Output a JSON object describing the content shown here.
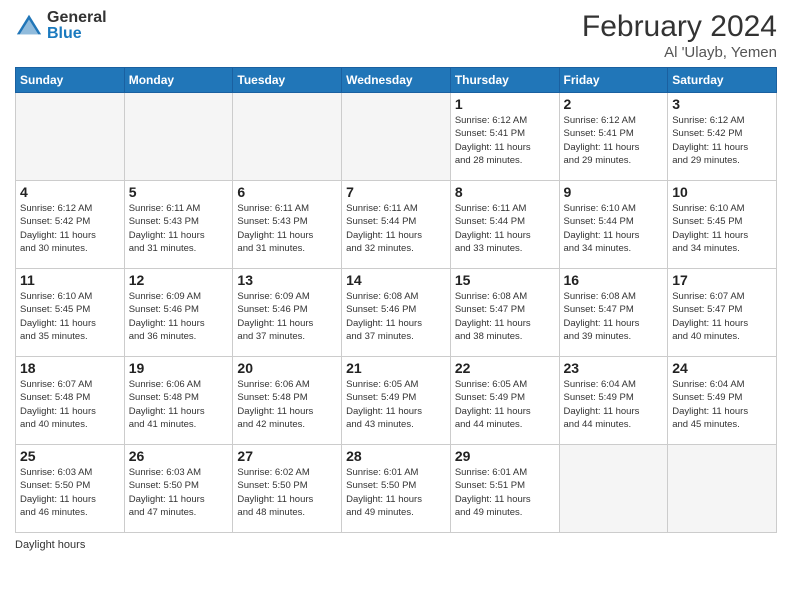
{
  "header": {
    "logo_general": "General",
    "logo_blue": "Blue",
    "title": "February 2024",
    "subtitle": "Al 'Ulayb, Yemen"
  },
  "days_of_week": [
    "Sunday",
    "Monday",
    "Tuesday",
    "Wednesday",
    "Thursday",
    "Friday",
    "Saturday"
  ],
  "footer": {
    "label": "Daylight hours"
  },
  "weeks": [
    [
      {
        "num": "",
        "detail": ""
      },
      {
        "num": "",
        "detail": ""
      },
      {
        "num": "",
        "detail": ""
      },
      {
        "num": "",
        "detail": ""
      },
      {
        "num": "1",
        "detail": "Sunrise: 6:12 AM\nSunset: 5:41 PM\nDaylight: 11 hours\nand 28 minutes."
      },
      {
        "num": "2",
        "detail": "Sunrise: 6:12 AM\nSunset: 5:41 PM\nDaylight: 11 hours\nand 29 minutes."
      },
      {
        "num": "3",
        "detail": "Sunrise: 6:12 AM\nSunset: 5:42 PM\nDaylight: 11 hours\nand 29 minutes."
      }
    ],
    [
      {
        "num": "4",
        "detail": "Sunrise: 6:12 AM\nSunset: 5:42 PM\nDaylight: 11 hours\nand 30 minutes."
      },
      {
        "num": "5",
        "detail": "Sunrise: 6:11 AM\nSunset: 5:43 PM\nDaylight: 11 hours\nand 31 minutes."
      },
      {
        "num": "6",
        "detail": "Sunrise: 6:11 AM\nSunset: 5:43 PM\nDaylight: 11 hours\nand 31 minutes."
      },
      {
        "num": "7",
        "detail": "Sunrise: 6:11 AM\nSunset: 5:44 PM\nDaylight: 11 hours\nand 32 minutes."
      },
      {
        "num": "8",
        "detail": "Sunrise: 6:11 AM\nSunset: 5:44 PM\nDaylight: 11 hours\nand 33 minutes."
      },
      {
        "num": "9",
        "detail": "Sunrise: 6:10 AM\nSunset: 5:44 PM\nDaylight: 11 hours\nand 34 minutes."
      },
      {
        "num": "10",
        "detail": "Sunrise: 6:10 AM\nSunset: 5:45 PM\nDaylight: 11 hours\nand 34 minutes."
      }
    ],
    [
      {
        "num": "11",
        "detail": "Sunrise: 6:10 AM\nSunset: 5:45 PM\nDaylight: 11 hours\nand 35 minutes."
      },
      {
        "num": "12",
        "detail": "Sunrise: 6:09 AM\nSunset: 5:46 PM\nDaylight: 11 hours\nand 36 minutes."
      },
      {
        "num": "13",
        "detail": "Sunrise: 6:09 AM\nSunset: 5:46 PM\nDaylight: 11 hours\nand 37 minutes."
      },
      {
        "num": "14",
        "detail": "Sunrise: 6:08 AM\nSunset: 5:46 PM\nDaylight: 11 hours\nand 37 minutes."
      },
      {
        "num": "15",
        "detail": "Sunrise: 6:08 AM\nSunset: 5:47 PM\nDaylight: 11 hours\nand 38 minutes."
      },
      {
        "num": "16",
        "detail": "Sunrise: 6:08 AM\nSunset: 5:47 PM\nDaylight: 11 hours\nand 39 minutes."
      },
      {
        "num": "17",
        "detail": "Sunrise: 6:07 AM\nSunset: 5:47 PM\nDaylight: 11 hours\nand 40 minutes."
      }
    ],
    [
      {
        "num": "18",
        "detail": "Sunrise: 6:07 AM\nSunset: 5:48 PM\nDaylight: 11 hours\nand 40 minutes."
      },
      {
        "num": "19",
        "detail": "Sunrise: 6:06 AM\nSunset: 5:48 PM\nDaylight: 11 hours\nand 41 minutes."
      },
      {
        "num": "20",
        "detail": "Sunrise: 6:06 AM\nSunset: 5:48 PM\nDaylight: 11 hours\nand 42 minutes."
      },
      {
        "num": "21",
        "detail": "Sunrise: 6:05 AM\nSunset: 5:49 PM\nDaylight: 11 hours\nand 43 minutes."
      },
      {
        "num": "22",
        "detail": "Sunrise: 6:05 AM\nSunset: 5:49 PM\nDaylight: 11 hours\nand 44 minutes."
      },
      {
        "num": "23",
        "detail": "Sunrise: 6:04 AM\nSunset: 5:49 PM\nDaylight: 11 hours\nand 44 minutes."
      },
      {
        "num": "24",
        "detail": "Sunrise: 6:04 AM\nSunset: 5:49 PM\nDaylight: 11 hours\nand 45 minutes."
      }
    ],
    [
      {
        "num": "25",
        "detail": "Sunrise: 6:03 AM\nSunset: 5:50 PM\nDaylight: 11 hours\nand 46 minutes."
      },
      {
        "num": "26",
        "detail": "Sunrise: 6:03 AM\nSunset: 5:50 PM\nDaylight: 11 hours\nand 47 minutes."
      },
      {
        "num": "27",
        "detail": "Sunrise: 6:02 AM\nSunset: 5:50 PM\nDaylight: 11 hours\nand 48 minutes."
      },
      {
        "num": "28",
        "detail": "Sunrise: 6:01 AM\nSunset: 5:50 PM\nDaylight: 11 hours\nand 49 minutes."
      },
      {
        "num": "29",
        "detail": "Sunrise: 6:01 AM\nSunset: 5:51 PM\nDaylight: 11 hours\nand 49 minutes."
      },
      {
        "num": "",
        "detail": ""
      },
      {
        "num": "",
        "detail": ""
      }
    ]
  ]
}
